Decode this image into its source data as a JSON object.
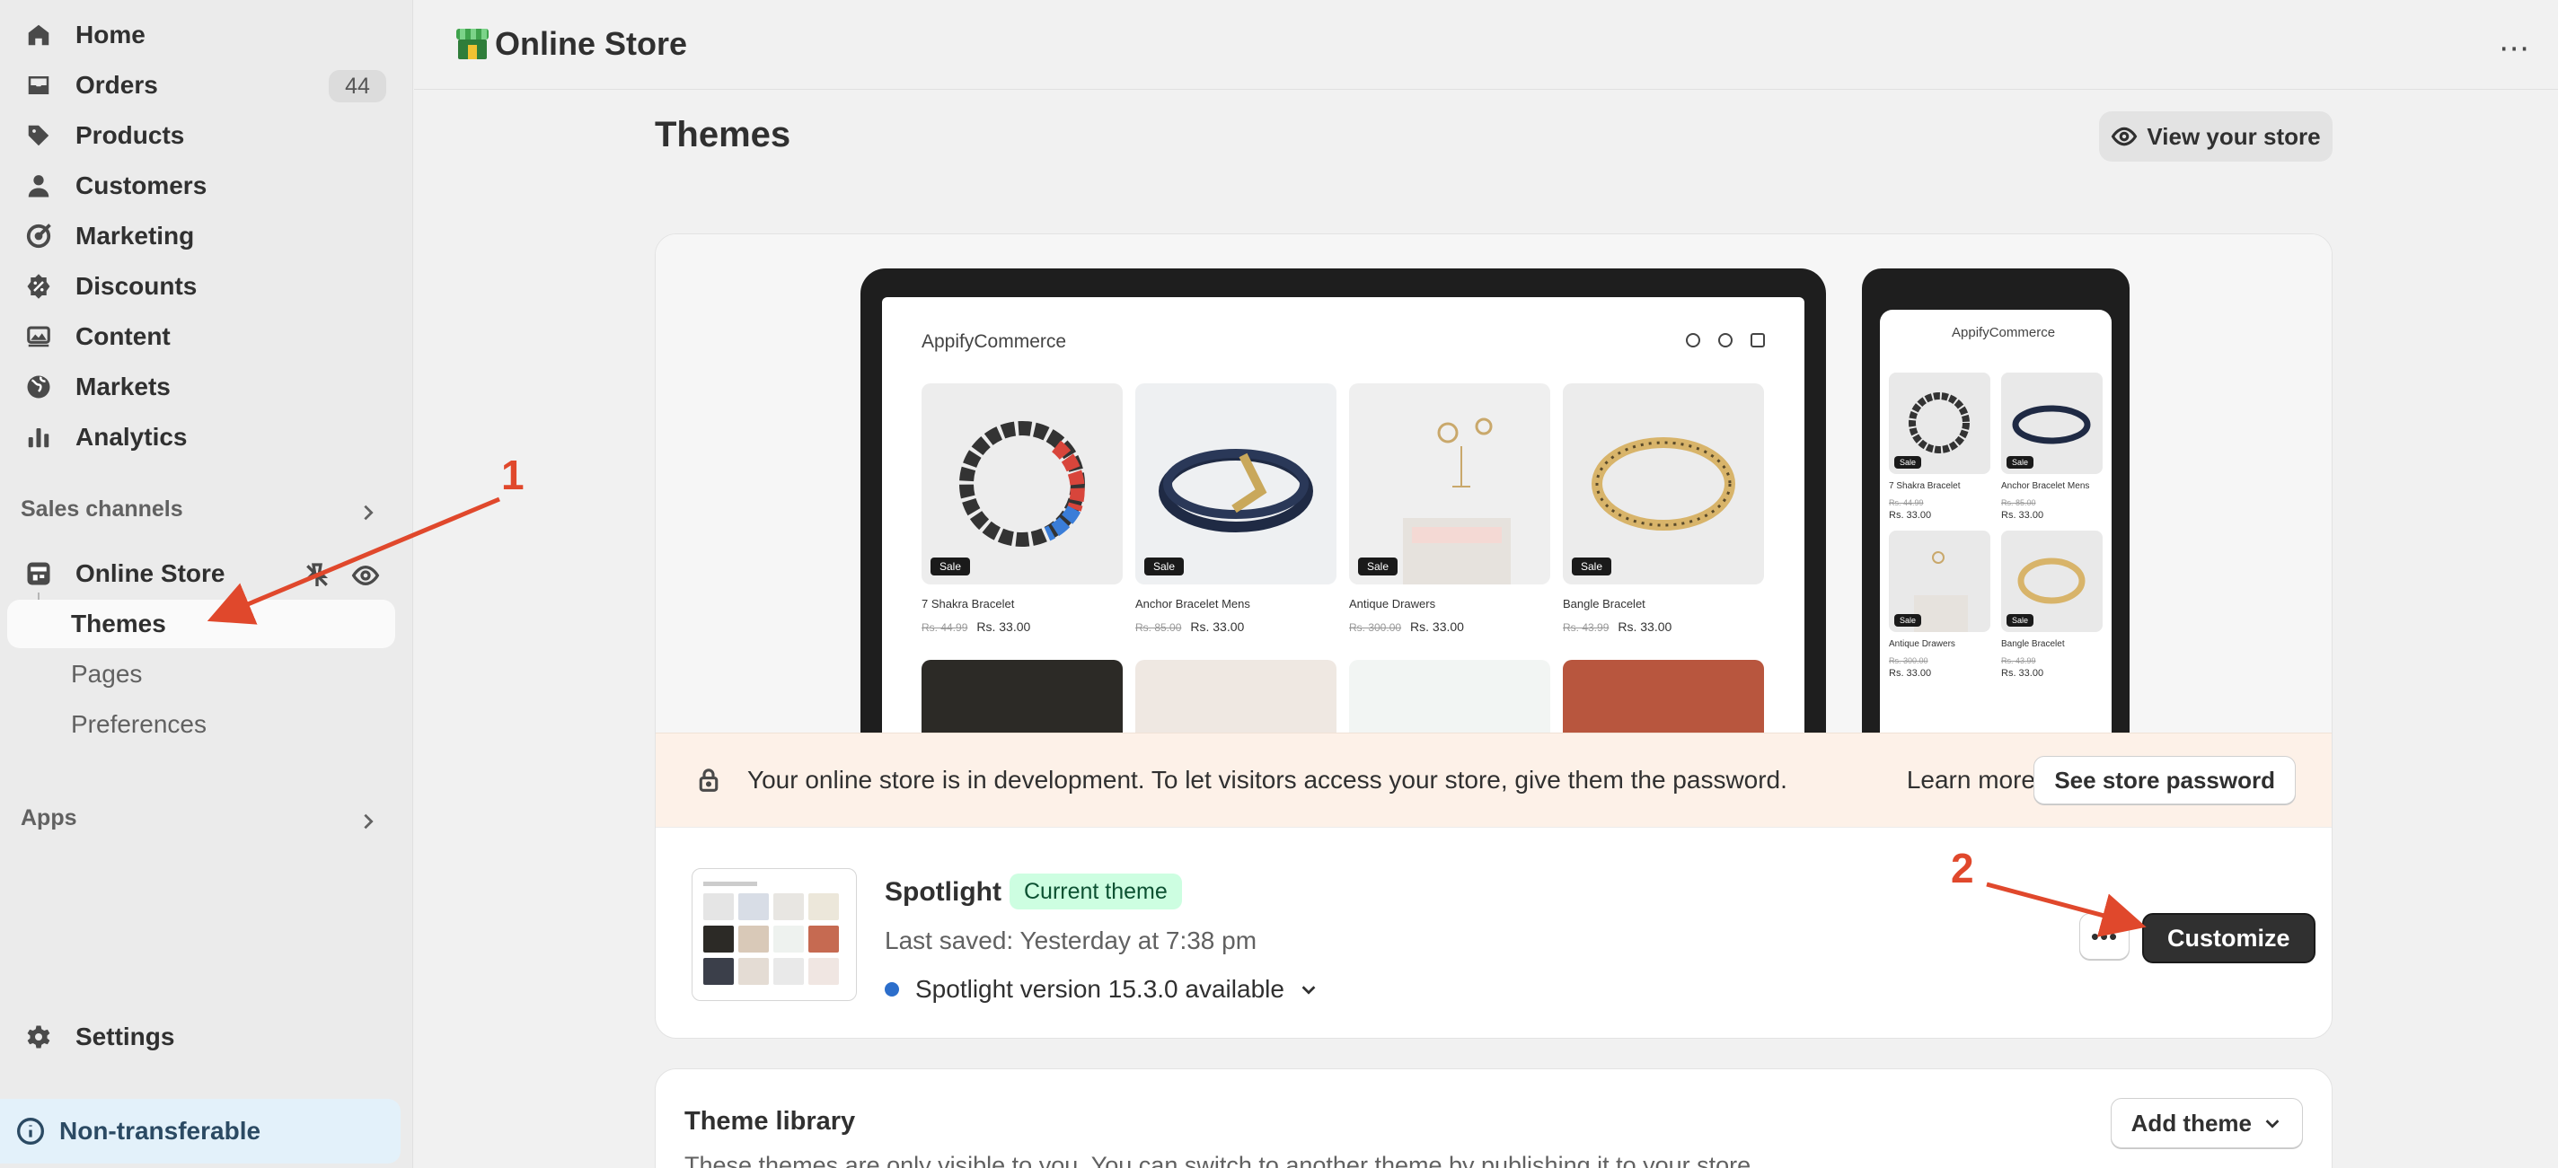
{
  "sidebar": {
    "nav": [
      {
        "label": "Home",
        "icon": "home-icon"
      },
      {
        "label": "Orders",
        "icon": "orders-icon",
        "badge": "44"
      },
      {
        "label": "Products",
        "icon": "tag-icon"
      },
      {
        "label": "Customers",
        "icon": "person-icon"
      },
      {
        "label": "Marketing",
        "icon": "target-icon"
      },
      {
        "label": "Discounts",
        "icon": "discount-icon"
      },
      {
        "label": "Content",
        "icon": "image-icon"
      },
      {
        "label": "Markets",
        "icon": "globe-icon"
      },
      {
        "label": "Analytics",
        "icon": "bar-chart-icon"
      }
    ],
    "sales_channels_label": "Sales channels",
    "online_store_label": "Online Store",
    "sub_items": [
      "Themes",
      "Pages",
      "Preferences"
    ],
    "apps_label": "Apps",
    "settings_label": "Settings",
    "non_transferable_label": "Non-transferable"
  },
  "header": {
    "title": "Online Store",
    "more": "⋯"
  },
  "page": {
    "title": "Themes",
    "view_store_label": "View your store"
  },
  "preview": {
    "desktop_logo": "AppifyCommerce",
    "phone_logo": "AppifyCommerce",
    "sale_label": "Sale",
    "products": [
      {
        "name": "7 Shakra Bracelet",
        "old_price": "Rs. 44.99",
        "price": "Rs. 33.00"
      },
      {
        "name": "Anchor Bracelet Mens",
        "old_price": "Rs. 85.00",
        "price": "Rs. 33.00"
      },
      {
        "name": "Antique Drawers",
        "old_price": "Rs. 300.00",
        "price": "Rs. 33.00"
      },
      {
        "name": "Bangle Bracelet",
        "old_price": "Rs. 43.99",
        "price": "Rs. 33.00"
      }
    ]
  },
  "banner": {
    "message": "Your online store is in development. To let visitors access your store, give them the password.",
    "learn_more": "Learn more",
    "password_button": "See store password"
  },
  "theme": {
    "name": "Spotlight",
    "badge": "Current theme",
    "last_saved": "Last saved: Yesterday at 7:38 pm",
    "version": "Spotlight version 15.3.0 available",
    "more_button": "•••",
    "customize_button": "Customize"
  },
  "library": {
    "title": "Theme library",
    "description": "These themes are only visible to you. You can switch to another theme by publishing it to your store.",
    "add_theme_button": "Add theme"
  },
  "annotations": {
    "step1": "1",
    "step2": "2",
    "color": "#e0482c"
  }
}
